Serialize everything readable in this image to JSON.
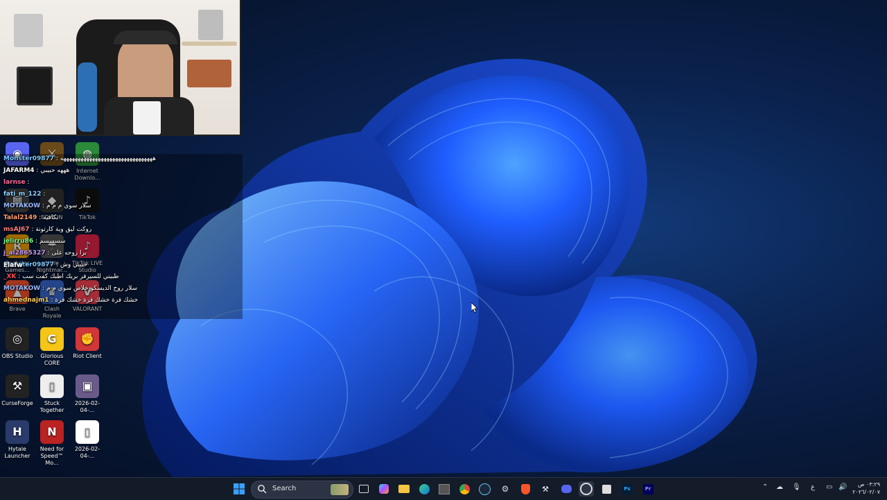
{
  "chat": {
    "messages": [
      {
        "user": "Monster09877",
        "text": "ههههههههههههههههههههههههههههههههه",
        "color": "#7ec8ff"
      },
      {
        "user": "JAFARM4",
        "text": "هههه حبيبي",
        "color": "#ffffff"
      },
      {
        "user": "larnse",
        "text": "",
        "color": "#ff6b9a"
      },
      {
        "user": "fati_m_122",
        "text": "",
        "color": "#8fd0ff"
      },
      {
        "user": "MOTAKOW",
        "text": "سلار سوي م م م",
        "color": "#9ab8ff"
      },
      {
        "user": "Talal2149",
        "text": "بكافيه",
        "color": "#ff9c6b"
      },
      {
        "user": "msAJ67",
        "text": "روكت ليق وية كارتونة",
        "color": "#ff7f7f"
      },
      {
        "user": "jelirru86",
        "text": "سسسسم",
        "color": "#7dff8a"
      },
      {
        "user": "j_al2865327",
        "text": "برا روحه على",
        "color": "#c49bff"
      },
      {
        "user": "Monster09877",
        "text": "حبيبي وش",
        "color": "#7ec8ff"
      },
      {
        "user": "_XK",
        "text": "طبيني للسيرفر بريك اطبك كفت سب",
        "color": "#ff4b4b"
      },
      {
        "user": "MOTAKOW",
        "text": "سلار روح الديسكو خلاص سوي م م",
        "color": "#9ab8ff"
      },
      {
        "user": "ahmednajm1",
        "text": "خشك فرة خشك فرة خشك فرة",
        "color": "#ffd15c"
      }
    ]
  },
  "desktop_icons": [
    {
      "name": "discord",
      "label": ""
    },
    {
      "name": "bf",
      "label": ""
    },
    {
      "name": "internet-download-manager",
      "label": "Internet Downlo..."
    },
    {
      "name": "elgato",
      "label": ""
    },
    {
      "name": "edison",
      "label": "EDISON"
    },
    {
      "name": "tiktok",
      "label": "TikTok"
    },
    {
      "name": "rockstar",
      "label": "Rockstar Games..."
    },
    {
      "name": "little-nightmares",
      "label": "Little Nightmar..."
    },
    {
      "name": "tiktok-live-studio",
      "label": "TikTok LIVE Studio"
    },
    {
      "name": "brave",
      "label": "Brave"
    },
    {
      "name": "clash-royale",
      "label": "Clash Royale"
    },
    {
      "name": "valorant",
      "label": "VALORANT"
    },
    {
      "name": "obs-studio",
      "label": "OBS Studio"
    },
    {
      "name": "glorious-core",
      "label": "Glorious CORE"
    },
    {
      "name": "riot-client",
      "label": "Riot Client"
    },
    {
      "name": "curseforge",
      "label": "CurseForge"
    },
    {
      "name": "stuck-together",
      "label": "Stuck Together"
    },
    {
      "name": "image-file-1",
      "label": "2026-02-04-..."
    },
    {
      "name": "hytale-launcher",
      "label": "Hytale Launcher"
    },
    {
      "name": "need-for-speed",
      "label": "Need for Speed™ Mo..."
    },
    {
      "name": "file-2",
      "label": "2026-02-04-..."
    }
  ],
  "overlay_label": "Elafw",
  "taskbar": {
    "search_label": "Search",
    "clock_time": "٠٣:٢٩ ص",
    "clock_date": "٢٠٢٦/٠٢/٠٧",
    "lang": "ع"
  },
  "colors": {
    "taskbar_bg": "#161c28",
    "wallpaper_primary": "#1a5cff",
    "wallpaper_dark": "#071632"
  }
}
